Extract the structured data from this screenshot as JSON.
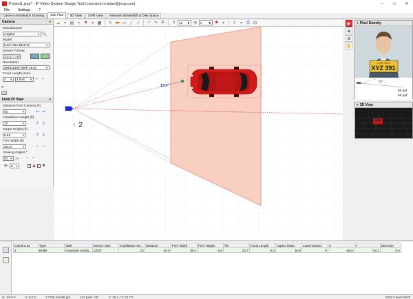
{
  "window": {
    "title": "Project1.jvsg* - IP Video System Design Tool (Licensed to brian@jvsg.com)",
    "minimize": "–",
    "maximize": "□",
    "close": "✕"
  },
  "menu": [
    "File",
    "Settings",
    "?"
  ],
  "tabs": [
    "Camera Installation Drawing",
    "Site Plan",
    "3D View",
    "DVR View",
    "Network Bandwidth & Disk Space"
  ],
  "active_tab": "Site Plan",
  "camera_panel": {
    "title": "Camera",
    "manufacturer_label": "Manufacturer",
    "manufacturer": "Axiglion",
    "model_label": "Model",
    "model": "8.0C-H5A-BO1-IR",
    "sensor_label": "Sensor Format",
    "sensor": "1/2.8\"",
    "resolution_label": "Resolution",
    "resolution": "3840x2160 (8MP 16:9)",
    "focal_label": "Focal Length (mm)",
    "focal_min": "4",
    "focal_range": "4.9~8"
  },
  "fov_panel": {
    "title": "Field Of View",
    "distance_label": "Distance from Camera (ft)",
    "distance": "40",
    "install_height_label": "Installation Height (ft)",
    "install_height": "12",
    "target_height_label": "Target Height (ft)",
    "target_height": "5.54",
    "fov_width_label": "FOV Width (ft)",
    "fov_width": "38.27",
    "viewing_angle_label": "Viewing Angles,°",
    "viewing_angle": "52",
    "viewing_angle_v": "29",
    "bottom_value": "0"
  },
  "toolbar": {
    "zoom": "12",
    "angle": "0"
  },
  "canvas": {
    "angle_label": "13.7°",
    "camera_number": "2"
  },
  "pixel_density": {
    "title": "Pixel Density",
    "plate": "XYZ 391",
    "plate_state": "CALIFORNIA",
    "angle": "25°",
    "ppf_h": "96 ppf",
    "ppf_v": "95 ppf"
  },
  "view3d": {
    "title": "3D View"
  },
  "table": {
    "headers": [
      "Camera ID",
      "Type",
      "Task",
      "Sensor Size",
      "Installation Hei...",
      "Distance",
      "FOV Width",
      "FOV Height",
      "Tilt",
      "Focal Length",
      "Aspect Ratio",
      "Lower Bound",
      "X",
      "Y",
      "Direction"
    ],
    "rows": [
      [
        "2",
        "Bullet",
        "Automatic Numb...",
        "1/2.8\"",
        "12",
        "40.0",
        "38.3",
        "5.5",
        "23.7",
        "6.0",
        "16:9",
        "0",
        "-45.5",
        "-34.1",
        "0.5"
      ]
    ]
  },
  "status": [
    "X: -60.5 ft",
    "Y: 6.0 ft",
    "1:7768 mm/96 ppf",
    "147 pxf/1: 25°",
    "X: 25.1 / Y: 23.7 ft",
    "2022.0 Build 3579"
  ],
  "colors": {
    "fov_fill": "#f8cfc0",
    "fov_stroke": "#e88a7a",
    "camera": "#1a2ad8",
    "car": "#d31a1a",
    "accent": "#1e78d7"
  }
}
